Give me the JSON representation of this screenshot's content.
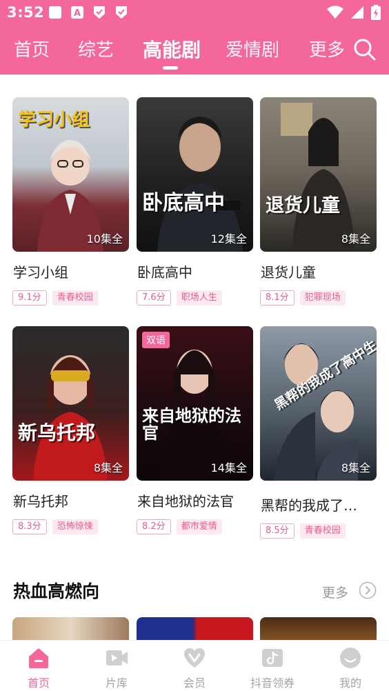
{
  "status_bar": {
    "time": "3:52"
  },
  "top_tabs": [
    {
      "label": "首页",
      "active": false
    },
    {
      "label": "综艺",
      "active": false
    },
    {
      "label": "高能剧",
      "active": true
    },
    {
      "label": "爱情剧",
      "active": false
    },
    {
      "label": "更多",
      "active": false
    }
  ],
  "cards": [
    {
      "name": "学习小组",
      "poster_title": "学习小组",
      "episodes": "10集全",
      "score": "9.1分",
      "genre": "青春校园"
    },
    {
      "name": "卧底高中",
      "poster_title": "卧底高中",
      "episodes": "12集全",
      "score": "7.6分",
      "genre": "职场人生"
    },
    {
      "name": "退货儿童",
      "poster_title": "退货儿童",
      "episodes": "8集全",
      "score": "8.1分",
      "genre": "犯罪现场"
    },
    {
      "name": "新乌托邦",
      "poster_title": "新乌托邦",
      "episodes": "8集全",
      "score": "8.3分",
      "genre": "恐怖惊悚"
    },
    {
      "name": "来自地狱的法官",
      "poster_title": "来自地狱的法官",
      "badge": "双语",
      "episodes": "14集全",
      "score": "8.2分",
      "genre": "都市爱情"
    },
    {
      "name": "黑帮的我成了…",
      "poster_title": "黑帮的我成了高中生",
      "episodes": "8集全",
      "score": "8.5分",
      "genre": "青春校园"
    }
  ],
  "section": {
    "title": "热血高燃向",
    "more": "更多"
  },
  "bottom_nav": [
    {
      "label": "首页",
      "icon": "home-icon",
      "active": true
    },
    {
      "label": "片库",
      "icon": "video-library-icon",
      "active": false
    },
    {
      "label": "会员",
      "icon": "vip-heart-icon",
      "active": false
    },
    {
      "label": "抖音领券",
      "icon": "douyin-coupon-icon",
      "active": false
    },
    {
      "label": "我的",
      "icon": "profile-face-icon",
      "active": false
    }
  ],
  "colors": {
    "brand": "#f4679b",
    "tag_text": "#e95d8f",
    "tag_bg": "#fdeaf1"
  }
}
